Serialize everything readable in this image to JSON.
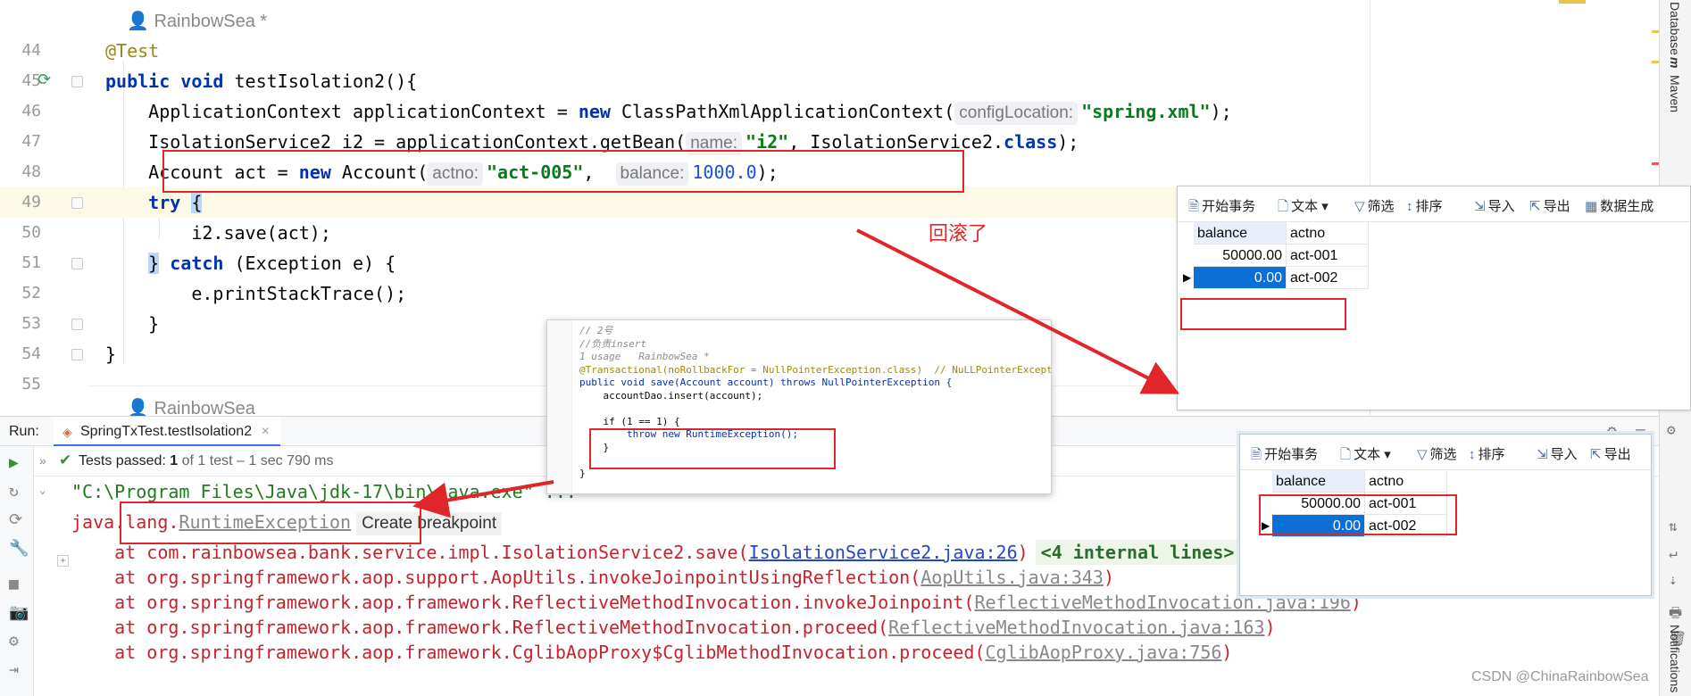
{
  "editor": {
    "author_top": "RainbowSea *",
    "author_bottom": "RainbowSea",
    "lines": [
      {
        "num": "44",
        "parts": [
          [
            "ann",
            "@Test"
          ]
        ]
      },
      {
        "num": "45",
        "parts": [
          [
            "kw",
            "public void "
          ],
          [
            "",
            "testIsolation2(){"
          ]
        ]
      },
      {
        "num": "46",
        "parts": [
          [
            "",
            "    ApplicationContext applicationContext = "
          ],
          [
            "kw",
            "new "
          ],
          [
            "",
            "ClassPathXmlApplicationContext("
          ],
          [
            "hint",
            "configLocation:"
          ],
          [
            "str",
            "\"spring.xml\""
          ],
          [
            "",
            ");"
          ]
        ]
      },
      {
        "num": "47",
        "parts": [
          [
            "",
            "    IsolationService2 i2 = applicationContext.getBean("
          ],
          [
            "hint",
            "name:"
          ],
          [
            "str",
            "\"i2\""
          ],
          [
            "",
            ", IsolationService2."
          ],
          [
            "kw",
            "class"
          ],
          [
            "",
            ");"
          ]
        ]
      },
      {
        "num": "48",
        "parts": [
          [
            "",
            "    Account act = "
          ],
          [
            "kw",
            "new "
          ],
          [
            "",
            "Account("
          ],
          [
            "hint",
            "actno:"
          ],
          [
            "str",
            "\"act-005\""
          ],
          [
            "",
            ",  "
          ],
          [
            "hint",
            "balance:"
          ],
          [
            "num",
            "1000.0"
          ],
          [
            "",
            ");"
          ]
        ]
      },
      {
        "num": "49",
        "parts": [
          [
            "",
            "    "
          ],
          [
            "kw",
            "try "
          ],
          [
            "brace",
            "{"
          ]
        ]
      },
      {
        "num": "50",
        "parts": [
          [
            "",
            "        i2.save(act);"
          ]
        ]
      },
      {
        "num": "51",
        "parts": [
          [
            "",
            "    "
          ],
          [
            "brace",
            "}"
          ],
          [
            "kw",
            " catch "
          ],
          [
            "",
            "(Exception e) {"
          ]
        ]
      },
      {
        "num": "52",
        "parts": [
          [
            "",
            "        e.printStackTrace();"
          ]
        ]
      },
      {
        "num": "53",
        "parts": [
          [
            "",
            "    }"
          ]
        ]
      },
      {
        "num": "54",
        "parts": [
          [
            "",
            "}"
          ]
        ]
      },
      {
        "num": "55",
        "parts": []
      }
    ]
  },
  "run": {
    "label": "Run:",
    "tab": "SpringTxTest.testIsolation2",
    "tests_passed": "Tests passed:",
    "count": "1",
    "detail": "of 1 test – 1 sec 790 ms"
  },
  "console": {
    "line1": "\"C:\\Program Files\\Java\\jdk-17\\bin\\java.exe\" ...",
    "line2_prefix": "java.lang.",
    "line2_exception": "RuntimeException",
    "line2_hint": "Create breakpoint",
    "frames": [
      {
        "text": "    at com.rainbowsea.bank.service.impl.IsolationService2.save(",
        "link": "IsolationService2.java:26",
        "suffix": ")",
        "internal": "<4 internal lines>",
        "blue": true
      },
      {
        "text": "    at org.springframework.aop.support.AopUtils.invokeJoinpointUsingReflection(",
        "link": "AopUtils.java:343",
        "suffix": ")",
        "internal": "",
        "blue": false
      },
      {
        "text": "    at org.springframework.aop.framework.ReflectiveMethodInvocation.invokeJoinpoint(",
        "link": "ReflectiveMethodInvocation.java:196",
        "suffix": ")",
        "internal": "",
        "blue": false
      },
      {
        "text": "    at org.springframework.aop.framework.ReflectiveMethodInvocation.proceed(",
        "link": "ReflectiveMethodInvocation.java:163",
        "suffix": ")",
        "internal": "",
        "blue": false
      },
      {
        "text": "    at org.springframework.aop.framework.CglibAopProxy$CglibMethodInvocation.proceed(",
        "link": "CglibAopProxy.java:756",
        "suffix": ")",
        "internal": "",
        "blue": false
      }
    ]
  },
  "db_panel": {
    "toolbar": [
      "开始事务",
      "文本",
      "筛选",
      "排序",
      "导入",
      "导出",
      "数据生成"
    ],
    "headers": [
      "balance",
      "actno"
    ],
    "rows1": [
      [
        "50000.00",
        "act-001"
      ],
      [
        "0.00",
        "act-002"
      ]
    ],
    "rows2": [
      [
        "50000.00",
        "act-001"
      ],
      [
        "0.00",
        "act-002"
      ]
    ]
  },
  "snippet": {
    "lines": [
      [
        "snc",
        "// 2号"
      ],
      [
        "snc",
        "//负责insert"
      ],
      [
        "snc",
        "1 usage   RainbowSea *"
      ],
      [
        "code",
        "@Transactional(noRollbackFor = NullPointerException.class)  // NuLLPointerExcept"
      ],
      [
        "code",
        "public void save(Account account) throws NullPointerException {"
      ],
      [
        "code",
        "    accountDao.insert(account);"
      ],
      [
        "code",
        ""
      ],
      [
        "code",
        "    if (1 == 1) {"
      ],
      [
        "code",
        "        throw new RuntimeException();"
      ],
      [
        "code",
        "    }"
      ],
      [
        "code",
        ""
      ],
      [
        "code",
        "}"
      ]
    ]
  },
  "annotation": {
    "rollback": "回滚了"
  },
  "right_strip": {
    "database": "Database",
    "maven": "Maven",
    "notifications": "Notifications"
  },
  "watermark": "CSDN @ChinaRainbowSea"
}
